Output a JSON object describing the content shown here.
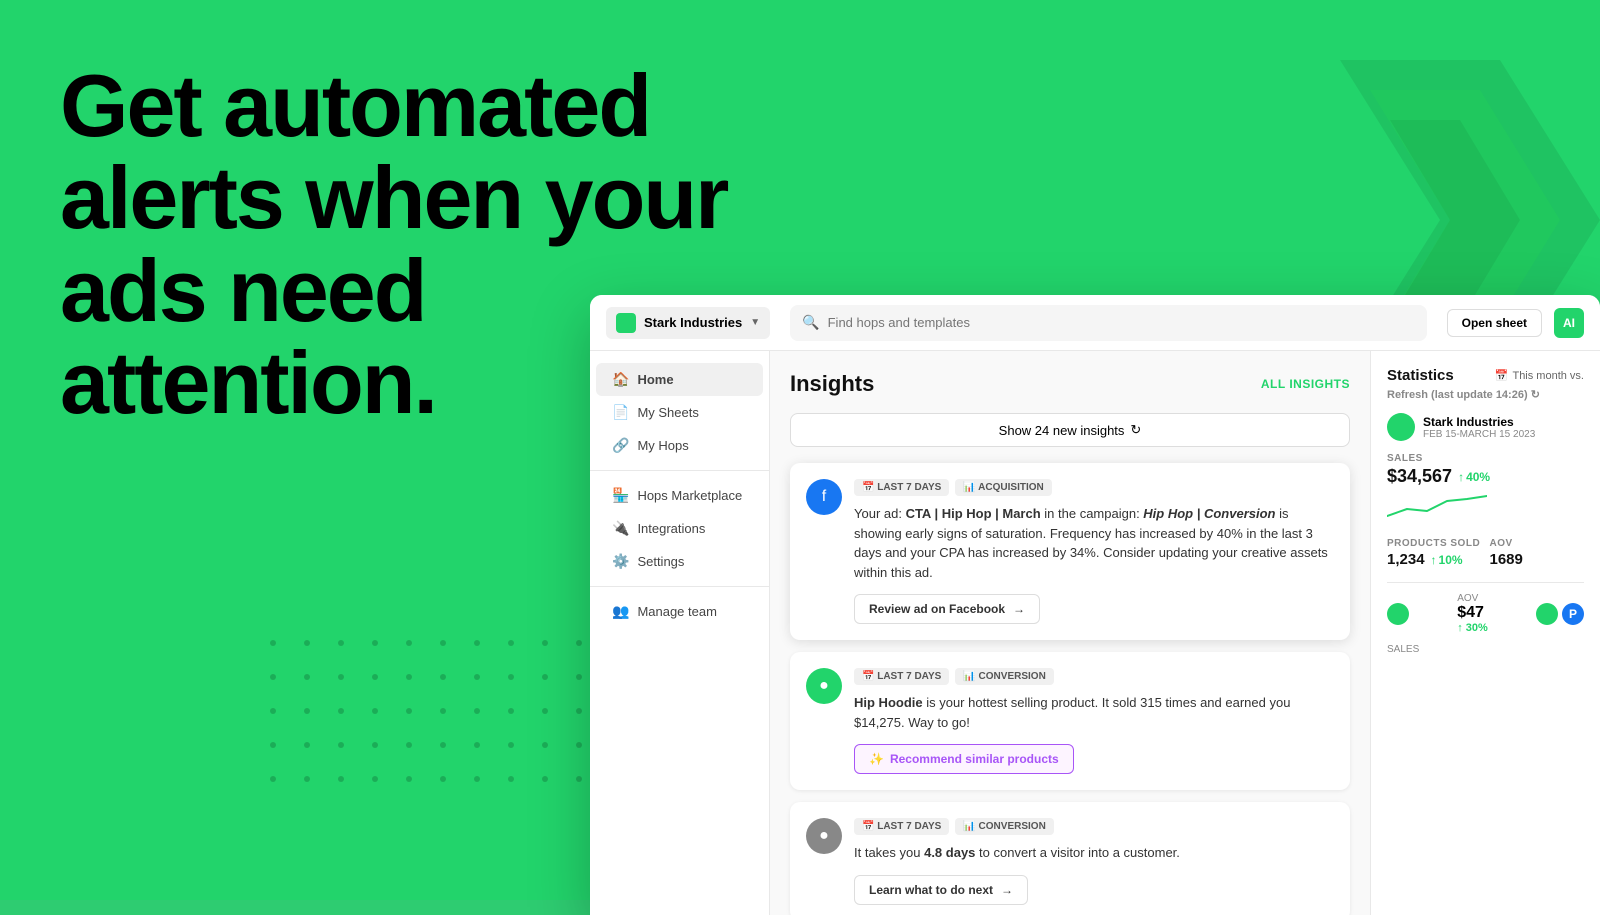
{
  "hero": {
    "line1": "Get automated",
    "line2": "alerts when your",
    "line3": "ads need",
    "line4": "attention."
  },
  "topbar": {
    "workspace": "Stark Industries",
    "search_placeholder": "Find hops and templates",
    "open_sheet": "Open sheet",
    "avatar_initials": "AI"
  },
  "sidebar": {
    "items": [
      {
        "label": "Home",
        "icon": "🏠",
        "active": true
      },
      {
        "label": "My Sheets",
        "icon": "📄",
        "active": false
      },
      {
        "label": "My Hops",
        "icon": "🔗",
        "active": false
      }
    ],
    "section2": [
      {
        "label": "Hops Marketplace",
        "icon": "🏪",
        "active": false
      },
      {
        "label": "Integrations",
        "icon": "🔌",
        "active": false
      },
      {
        "label": "Settings",
        "icon": "⚙️",
        "active": false
      }
    ],
    "section3": [
      {
        "label": "Manage team",
        "icon": "👥",
        "active": false
      }
    ]
  },
  "insights": {
    "title": "Insights",
    "all_insights_label": "ALL INSIGHTS",
    "show_new_btn": "Show 24 new insights",
    "cards": [
      {
        "id": "card1",
        "icon_type": "facebook",
        "badge_time": "LAST 7 DAYS",
        "badge_type": "ACQUISITION",
        "text_html": "Your ad: <strong>CTA | Hip Hop | March</strong> in the campaign: <strong><em>Hip Hop | Conversion</em></strong> is showing early signs of saturation. Frequency has increased by 40% in the last 3 days and your CPA has increased by 34%. Consider updating your creative assets within this ad.",
        "action_label": "Review ad on Facebook",
        "action_type": "default"
      },
      {
        "id": "card2",
        "icon_type": "green",
        "badge_time": "LAST 7 DAYS",
        "badge_type": "CONVERSION",
        "text_html": "<strong>Hip Hoodie</strong> is your hottest selling product. It sold 315 times and earned you $14,275. Way to go!",
        "action_label": "Recommend similar products",
        "action_type": "purple"
      },
      {
        "id": "card3",
        "icon_type": "gray",
        "badge_time": "LAST 7 DAYS",
        "badge_type": "CONVERSION",
        "text_html": "It takes you <strong>4.8 days</strong> to convert a visitor into a customer.",
        "action_label": "Learn what to do next",
        "action_type": "default"
      }
    ]
  },
  "statistics": {
    "title": "Statistics",
    "period": "This month vs.",
    "refresh_label": "Refresh",
    "last_update": "(last update 14:26)",
    "account": {
      "name": "Stark Industries",
      "date_range": "FEB 15-MARCH 15 2023"
    },
    "sales_label": "SALES",
    "sales_value": "$34,567",
    "sales_change": "40%",
    "products_sold_label": "PRODUCTS SOLD",
    "products_sold_value": "1,234",
    "products_sold_change": "10%",
    "aov_label": "AOV",
    "aov_value": "1689",
    "row2_aov_label": "AOV",
    "row2_aov_value": "$47",
    "row2_aov_change": "30%",
    "row2_sales_label": "SALES"
  }
}
